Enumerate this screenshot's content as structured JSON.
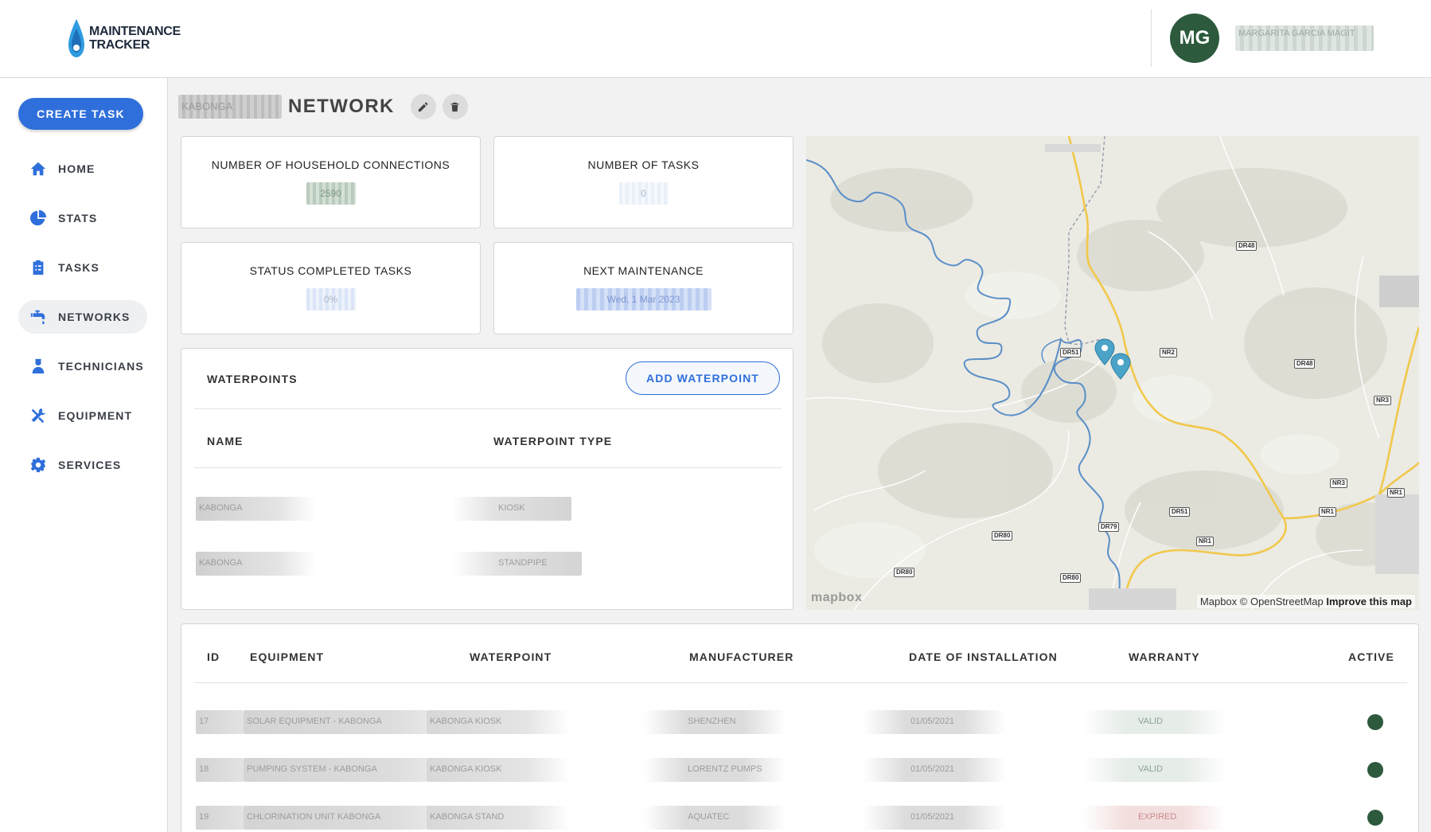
{
  "header": {
    "logo_line1": "MAINTENANCE",
    "logo_line2": "TRACKER",
    "avatar_initials": "MG",
    "user_name": "MARGARITA GARCIA MAGIT"
  },
  "sidebar": {
    "create_task_label": "CREATE TASK",
    "items": [
      {
        "label": "HOME",
        "icon": "home-icon"
      },
      {
        "label": "STATS",
        "icon": "pie-chart-icon"
      },
      {
        "label": "TASKS",
        "icon": "clipboard-icon"
      },
      {
        "label": "NETWORKS",
        "icon": "faucet-icon",
        "active": true
      },
      {
        "label": "TECHNICIANS",
        "icon": "technician-icon"
      },
      {
        "label": "EQUIPMENT",
        "icon": "tools-icon"
      },
      {
        "label": "SERVICES",
        "icon": "gear-icon"
      }
    ]
  },
  "page": {
    "network_name": "KABONGA",
    "title_suffix": "NETWORK"
  },
  "stats": {
    "household_label": "NUMBER OF HOUSEHOLD CONNECTIONS",
    "household_value": "2590",
    "tasks_label": "NUMBER OF TASKS",
    "tasks_value": "0",
    "completed_label": "STATUS COMPLETED TASKS",
    "completed_value": "0%",
    "next_label": "NEXT MAINTENANCE",
    "next_value": "Wed, 1 Mar 2023"
  },
  "waterpoints": {
    "title": "WATERPOINTS",
    "add_label": "ADD WATERPOINT",
    "col_name": "NAME",
    "col_type": "WATERPOINT TYPE",
    "rows": [
      {
        "name": "KABONGA",
        "type": "KIOSK"
      },
      {
        "name": "KABONGA",
        "type": "STANDPIPE"
      }
    ]
  },
  "map": {
    "attribution": "Mapbox © OpenStreetMap",
    "improve": "Improve this map",
    "logo": "mapbox",
    "roads": [
      "DR48",
      "NR2",
      "DR48",
      "NR3",
      "DR51",
      "DR51",
      "DR79",
      "NR1",
      "DR80",
      "DR80",
      "DR80",
      "NR3",
      "NR1",
      "NR1"
    ]
  },
  "equipment": {
    "columns": [
      "ID",
      "EQUIPMENT",
      "WATERPOINT",
      "MANUFACTURER",
      "DATE OF INSTALLATION",
      "WARRANTY",
      "ACTIVE"
    ],
    "rows": [
      {
        "id": "17",
        "equipment": "SOLAR EQUIPMENT - KABONGA",
        "waterpoint": "KABONGA KIOSK",
        "manufacturer": "SHENZHEN",
        "date": "01/05/2021",
        "warranty": "VALID",
        "active": true
      },
      {
        "id": "18",
        "equipment": "PUMPING SYSTEM - KABONGA",
        "waterpoint": "KABONGA KIOSK",
        "manufacturer": "LORENTZ PUMPS",
        "date": "01/05/2021",
        "warranty": "VALID",
        "active": true
      },
      {
        "id": "19",
        "equipment": "CHLORINATION UNIT KABONGA",
        "waterpoint": "KABONGA STAND",
        "manufacturer": "AQUATEC",
        "date": "01/05/2021",
        "warranty": "EXPIRED",
        "active": true
      }
    ]
  },
  "colors": {
    "primary": "#2f6fdb",
    "active_dot": "#2d5a3d",
    "avatar_bg": "#2d5a3d"
  }
}
